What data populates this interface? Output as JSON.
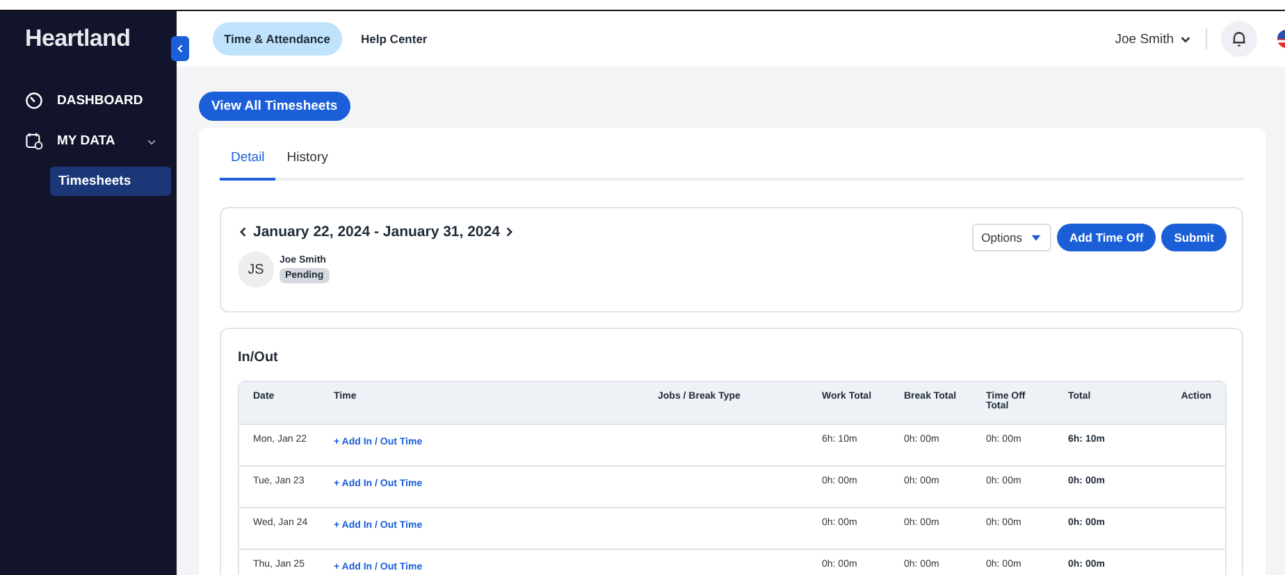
{
  "sidebar": {
    "logo": "Heartland",
    "items": [
      {
        "kind": "nav",
        "label": "DASHBOARD"
      },
      {
        "kind": "group",
        "label": "MY DATA",
        "expanded": true,
        "children": [
          {
            "label": "Timesheets",
            "selected": true
          }
        ]
      }
    ]
  },
  "header": {
    "tabs": [
      {
        "label": "Time & Attendance",
        "selected": true
      },
      {
        "label": "Help Center",
        "selected": false
      }
    ],
    "user": "Joe Smith"
  },
  "view_all_button": "View All Timesheets",
  "tabs": [
    {
      "label": "Detail",
      "selected": true
    },
    {
      "label": "History",
      "selected": false
    }
  ],
  "period": {
    "range": "January 22, 2024 - January 31, 2024",
    "employee": {
      "initials": "JS",
      "name": "Joe Smith",
      "status": "Pending"
    },
    "options": "Options",
    "buttons": [
      "Add Time Off",
      "Submit"
    ]
  },
  "in_out": {
    "title": "In/Out",
    "columns": [
      "Date",
      "Time",
      "Jobs / Break Type",
      "Work Total",
      "Break Total",
      "Time Off Total",
      "Total",
      "Action"
    ],
    "rows": [
      {
        "date": "Mon, Jan 22",
        "time": "+ Add In / Out Time",
        "work": "6h: 10m",
        "break": "0h: 00m",
        "time_off": "0h: 00m",
        "total": "6h: 10m"
      },
      {
        "date": "Tue, Jan 23",
        "time": "+ Add In / Out Time",
        "work": "0h: 00m",
        "break": "0h: 00m",
        "time_off": "0h: 00m",
        "total": "0h: 00m"
      },
      {
        "date": "Wed, Jan 24",
        "time": "+ Add In / Out Time",
        "work": "0h: 00m",
        "break": "0h: 00m",
        "time_off": "0h: 00m",
        "total": "0h: 00m"
      },
      {
        "date": "Thu, Jan 25",
        "time": "+ Add In / Out Time",
        "work": "0h: 00m",
        "break": "0h: 00m",
        "time_off": "0h: 00m",
        "total": "0h: 00m"
      }
    ]
  }
}
